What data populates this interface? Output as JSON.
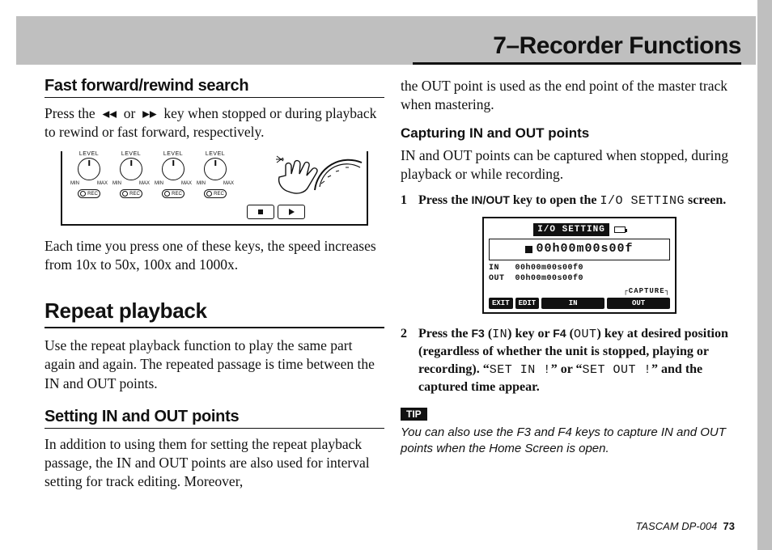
{
  "header": {
    "title": "7–Recorder Functions"
  },
  "left": {
    "h_ff": "Fast forward/rewind search",
    "p_ff": "Press the  ◂◂  or  ▸▸  key when stopped or during playback to rewind or fast forward, respectively.",
    "p_speed": "Each time you press one of these keys, the speed increases from 10x to 50x, 100x and 1000x.",
    "h_repeat": "Repeat playback",
    "p_repeat": "Use the repeat playback function to play the same part again and again. The repeated passage is time between the IN and OUT points.",
    "h_inout": "Setting IN and OUT points",
    "p_inout": "In addition to using them for setting the repeat playback passage, the IN and OUT points are also used for interval setting for track editing. Moreover,",
    "illus": {
      "label_level": "LEVEL",
      "label_min": "MIN",
      "label_max": "MAX",
      "label_rec": "REC"
    }
  },
  "right": {
    "p_cont": "the OUT point is used as the end point of the master track when mastering.",
    "h_cap": "Capturing IN and OUT points",
    "p_cap": "IN and OUT points can be captured when stopped, during playback or while recording.",
    "step1": {
      "pre": "Press the ",
      "sc": "IN/OUT",
      "mid": " key to open the ",
      "mono": "I/O SETTING",
      "post": " screen."
    },
    "lcd": {
      "title": "I/O SETTING",
      "time": "00h00m00s00f",
      "in_line": "IN   00h00m00s00f0",
      "out_line": "OUT  00h00m00s00f0",
      "cap_label": "┌CAPTURE┐",
      "f1": "EXIT",
      "f2": "EDIT",
      "f3": "IN",
      "f4": "OUT"
    },
    "step2": {
      "a": "Press the ",
      "sc1": "F3",
      "b": " (",
      "mono1": "IN",
      "c": ") key or ",
      "sc2": "F4",
      "d": " (",
      "mono2": "OUT",
      "e": ") key at desired position (regardless of whether the unit is stopped, playing or recording). “",
      "mono3": "SET IN !",
      "f": "” or “",
      "mono4": "SET OUT !",
      "g": "” and the captured time appear."
    },
    "tip_label": "TIP",
    "tip_body": "You can also use the F3 and F4 keys to capture IN and OUT points when the Home Screen is open."
  },
  "footer": {
    "brand": "TASCAM  DP-004",
    "page": "73"
  }
}
